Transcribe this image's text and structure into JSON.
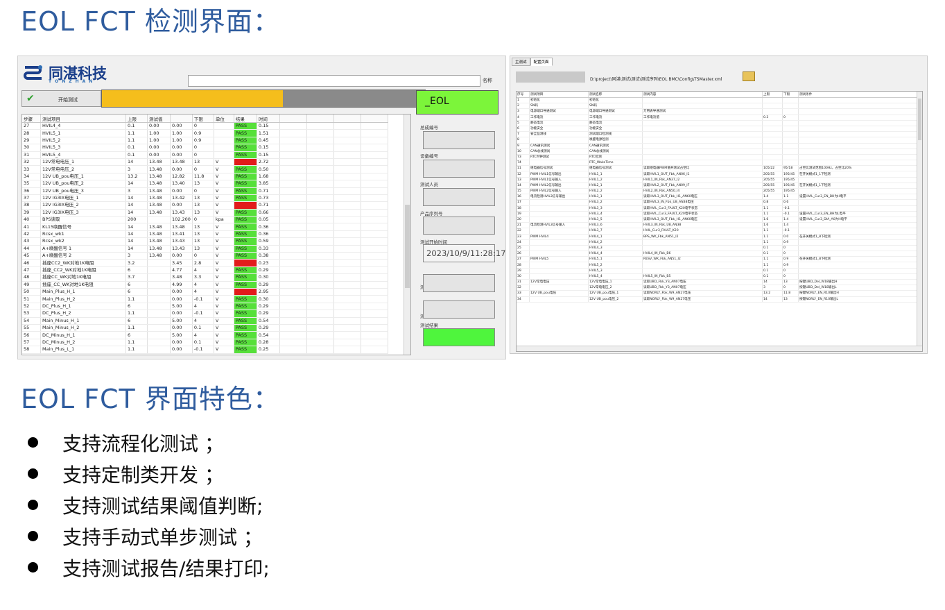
{
  "heading_top": "EOL FCT 检测界面：",
  "heading_bottom": "EOL FCT 界面特色：",
  "left_app": {
    "logo_text": "同湛科技",
    "logo_subtext": "TONZHAN",
    "top_input_label": "名称",
    "start_button": "开始测试",
    "progress": 0.56,
    "status_box": "_EOL",
    "columns": [
      "步骤",
      "测试项目",
      "上限",
      "测试值",
      "下限",
      "单位",
      "结果",
      "时间"
    ],
    "rows": [
      [
        "27",
        "HVIL4_4",
        "0.1",
        "0.00",
        "0.00",
        "0",
        "",
        "PASS",
        "0.15"
      ],
      [
        "28",
        "HVIL5_1",
        "1.1",
        "1.00",
        "1.00",
        "0.9",
        "",
        "PASS",
        "1.51"
      ],
      [
        "29",
        "HVIL5_2",
        "1.1",
        "1.00",
        "1.00",
        "0.9",
        "",
        "PASS",
        "0.45"
      ],
      [
        "30",
        "HVIL5_3",
        "0.1",
        "0.00",
        "0.00",
        "0",
        "",
        "PASS",
        "0.15"
      ],
      [
        "31",
        "HVIL5_4",
        "0.1",
        "0.00",
        "0.00",
        "0",
        "",
        "PASS",
        "0.15"
      ],
      [
        "32",
        "12V常电电压_1",
        "14",
        "13.48",
        "13.48",
        "13",
        "V",
        "FAIL",
        "2.72"
      ],
      [
        "33",
        "12V常电电压_2",
        "3",
        "13.48",
        "0.00",
        "0",
        "V",
        "PASS",
        "0.50"
      ],
      [
        "34",
        "12V UB_pou电压_1",
        "13.2",
        "13.48",
        "12.82",
        "11.8",
        "V",
        "PASS",
        "1.68"
      ],
      [
        "35",
        "12V UB_pou电压_2",
        "14",
        "13.48",
        "13.40",
        "13",
        "V",
        "PASS",
        "3.85"
      ],
      [
        "36",
        "12V UB_pou电压_3",
        "3",
        "13.48",
        "0.00",
        "0",
        "V",
        "PASS",
        "0.71"
      ],
      [
        "37",
        "12V IG3IX电压_1",
        "14",
        "13.48",
        "13.42",
        "13",
        "V",
        "PASS",
        "0.73"
      ],
      [
        "38",
        "12V IG3IX电压_2",
        "14",
        "13.48",
        "0.00",
        "13",
        "V",
        "FAIL",
        "0.71"
      ],
      [
        "39",
        "12V IG3IX电压_3",
        "14",
        "13.48",
        "13.43",
        "13",
        "V",
        "PASS",
        "0.66"
      ],
      [
        "40",
        "BPS读取",
        "200",
        "",
        "102.200",
        "0",
        "kpa",
        "PASS",
        "0.05"
      ],
      [
        "41",
        "KL15唤醒信号",
        "14",
        "13.48",
        "13.48",
        "13",
        "V",
        "PASS",
        "0.36"
      ],
      [
        "42",
        "Rcsx_wk1",
        "14",
        "13.48",
        "13.41",
        "13",
        "V",
        "PASS",
        "0.36"
      ],
      [
        "43",
        "Rcsx_wk2",
        "14",
        "13.48",
        "13.43",
        "13",
        "V",
        "PASS",
        "0.59"
      ],
      [
        "44",
        "A+唤醒信号 1",
        "14",
        "13.48",
        "13.43",
        "13",
        "V",
        "PASS",
        "0.33"
      ],
      [
        "45",
        "A+唤醒信号 2",
        "3",
        "13.48",
        "0.00",
        "0",
        "V",
        "PASS",
        "0.38"
      ],
      [
        "46",
        "插座CC2_WK对地1K电阻",
        "3.2",
        "",
        "3.45",
        "2.8",
        "V",
        "FAIL",
        "0.23"
      ],
      [
        "47",
        "插座_CC2_WK对地1K电阻",
        "6",
        "",
        "4.77",
        "4",
        "V",
        "PASS",
        "0.29"
      ],
      [
        "48",
        "插座CC_WK对地1K电阻",
        "3.7",
        "",
        "3.48",
        "3.3",
        "V",
        "PASS",
        "0.30"
      ],
      [
        "49",
        "插座_CC_WK对地1K电阻",
        "6",
        "",
        "4.99",
        "4",
        "V",
        "PASS",
        "0.29"
      ],
      [
        "50",
        "Main_Plus_H_1",
        "6",
        "",
        "0.00",
        "4",
        "V",
        "FAIL",
        "2.95"
      ],
      [
        "51",
        "Main_Plus_H_2",
        "1.1",
        "",
        "0.00",
        "-0.1",
        "V",
        "PASS",
        "0.30"
      ],
      [
        "52",
        "DC_Plus_H_1",
        "6",
        "",
        "5.00",
        "4",
        "V",
        "PASS",
        "0.29"
      ],
      [
        "53",
        "DC_Plus_H_2",
        "1.1",
        "",
        "0.00",
        "-0.1",
        "V",
        "PASS",
        "0.29"
      ],
      [
        "54",
        "Main_Minus_H_1",
        "6",
        "",
        "5.00",
        "4",
        "V",
        "PASS",
        "0.54"
      ],
      [
        "55",
        "Main_Minus_H_2",
        "1.1",
        "",
        "0.00",
        "0.1",
        "V",
        "PASS",
        "0.29"
      ],
      [
        "56",
        "DC_Minus_H_1",
        "6",
        "",
        "5.00",
        "4",
        "V",
        "PASS",
        "0.54"
      ],
      [
        "57",
        "DC_Minus_H_2",
        "1.1",
        "",
        "0.00",
        "0.1",
        "V",
        "PASS",
        "0.28"
      ],
      [
        "58",
        "Main_Plus_L_1",
        "1.1",
        "",
        "0.00",
        "-0.1",
        "V",
        "PASS",
        "0.25"
      ]
    ],
    "side_labels": [
      "总成编号",
      "设备编号",
      "测试人员",
      "产品序列号",
      "测试开始时间",
      "测试结束时间",
      "测试总用时",
      "测试结果"
    ],
    "start_time": "2023/10/9/11:28:17"
  },
  "right_app": {
    "tabs": [
      "主测试",
      "配置页面"
    ],
    "path": "D:\\project\\同湛\\测试\\测试\\测试序列\\EOL BMC\\Config\\TSMaster.xml",
    "columns": [
      "序号",
      "测试项目",
      "测试名称",
      "测试内容",
      "上限",
      "下限",
      "测试条件"
    ],
    "rows": [
      [
        "1",
        "初始化",
        "初始化",
        "",
        "",
        "",
        ""
      ],
      [
        "2",
        "SN码",
        "SN码",
        "",
        "",
        "",
        ""
      ],
      [
        "3",
        "电源端口导通测试",
        "电源端口导通测试",
        "万用表导通测试",
        "",
        "",
        ""
      ],
      [
        "4",
        "工作电流",
        "工作电流",
        "工作电流值",
        "0.3",
        "0",
        ""
      ],
      [
        "5",
        "静态电流",
        "静态电流",
        "",
        "",
        "",
        ""
      ],
      [
        "6",
        "功能安全",
        "功能安全",
        "",
        "",
        "",
        ""
      ],
      [
        "7",
        "安全监测线",
        "测试端口检测线",
        "",
        "",
        "",
        ""
      ],
      [
        "8",
        "",
        "唤醒电源检测",
        "",
        "",
        "",
        ""
      ],
      [
        "9",
        "CAN通讯测试",
        "CAN通讯测试",
        "",
        "",
        "",
        ""
      ],
      [
        "10",
        "CAN总线测试",
        "CAN总线测试",
        "",
        "",
        "",
        ""
      ],
      [
        "73",
        "RTC时钟测试",
        "RTC检测",
        "",
        "",
        "",
        ""
      ],
      [
        "74",
        "",
        "RTC_WakeTime",
        "",
        "",
        "",
        ""
      ],
      [
        "11",
        "继电器信号测试",
        "继电器信号测试",
        "读取继电器PWM值并测试占空比",
        "105/22",
        "95/18",
        "占空比测试范围100Hz，占空比20%"
      ],
      [
        "12",
        "PWM HVIL1信号输出",
        "HVIL1_1",
        "读取HVIL1_OUT_Fbk_AN06_I1",
        "205/55",
        "195/45",
        "在开关模式1_1下检测"
      ],
      [
        "13",
        "PWM HVIL1信号输入",
        "HVIL1_2",
        "HVIL1_IN_Fbk_AN37_I2",
        "205/55",
        "195/45",
        ""
      ],
      [
        "14",
        "PWM HVIL2信号输出",
        "HVIL2_1",
        "读取HVIL2_OUT_Fbk_AN09_I7",
        "205/55",
        "195/45",
        "在开关模式1_1下检测"
      ],
      [
        "15",
        "PWM HVIL2信号输入",
        "HVIL2_2",
        "HVIL2_IN_Fbk_AN50_I4",
        "205/55",
        "195/45",
        ""
      ],
      [
        "16",
        "电流检测HVIL3信号输出",
        "HVIL3_1",
        "读取HVIL3_OUT_Fbk_H1_AN60电压",
        "1.4",
        "1.1",
        "设置HVIL_Cur3_EN_BH为H电平"
      ],
      [
        "17",
        "",
        "HVIL3_2",
        "读取HVIL3_IN_Fbk_U8_AN38电压",
        "0.8",
        "0.6",
        ""
      ],
      [
        "18",
        "",
        "HVIL3_3",
        "读取HVIL_Cur3_FAULT_K20电平状态",
        "1.1",
        "-0.1",
        ""
      ],
      [
        "19",
        "",
        "HVIL3_4",
        "读取HVIL_Cur3_FAULT_K20电平状态",
        "1.1",
        "-0.1",
        "设置HVIL_Cur3_EN_BH为L电平"
      ],
      [
        "20",
        "",
        "HVIL3_5",
        "读取HVIL3_OUT_Fbk_H1_AN60电压",
        "1.6",
        "1.4",
        "设置HVIL_Cur3_DIA_A0为H电平"
      ],
      [
        "21",
        "电流检测HVIL3信号输入",
        "HVIL3_6",
        "HVIL3_IN_Fbk_U8_AN38",
        "1.6",
        "1.4",
        ""
      ],
      [
        "22",
        "",
        "HVIL3_7",
        "HVIL_Cur3_FAULT_K20",
        "1.1",
        "-0.1",
        ""
      ],
      [
        "23",
        "PWM HVIL4",
        "HVIL4_1",
        "BPS_WK_Fbk_AN51_I2",
        "1.1",
        "0.0",
        "在开关模式1_8下检测"
      ],
      [
        "24",
        "",
        "HVIL4_2",
        "",
        "1.1",
        "0.9",
        ""
      ],
      [
        "25",
        "",
        "HVIL4_3",
        "",
        "0.1",
        "0",
        ""
      ],
      [
        "26",
        "",
        "HVIL4_4",
        "HVIL4_IN_Fbk_B6",
        "0.1",
        "0",
        ""
      ],
      [
        "27",
        "PWM HVIL5",
        "HVIL5_1",
        "RESV_WK_Fbk_AN51_I2",
        "1.1",
        "0.9",
        "在开关模式1_8下检测"
      ],
      [
        "28",
        "",
        "HVIL5_2",
        "",
        "1.1",
        "0.9",
        ""
      ],
      [
        "29",
        "",
        "HVIL5_3",
        "",
        "0.1",
        "0",
        ""
      ],
      [
        "30",
        "",
        "HVIL5_4",
        "HVIL5_IN_Fbk_B5",
        "0.1",
        "0",
        ""
      ],
      [
        "31",
        "12V常电电压",
        "12V常电电压_1",
        "读取UBD_Fbk_Y3_AN07电压",
        "14",
        "13",
        "按键UBD_Del_W18输出H"
      ],
      [
        "32",
        "",
        "12V常电电压_2",
        "读取UBD_Fbk_Y3_AN07电压",
        "3",
        "0",
        "按键UBD_Del_W18输出L"
      ],
      [
        "33",
        "12V UB_pou电压",
        "12V UB_pou电压_1",
        "读取NORLY_Fbk_W9_AN27电压",
        "13.2",
        "11.8",
        "按键NORLY_EN_R10输出H"
      ],
      [
        "34",
        "",
        "12V UB_pou电压_2",
        "读取NORLY_Fbk_W9_AN27电压",
        "14",
        "13",
        "按键NORLY_EN_R10输出L"
      ]
    ]
  },
  "bullets": [
    "支持流程化测试 ；",
    "支持定制类开发 ；",
    "支持测试结果阈值判断;",
    "支持手动式单步测试 ；",
    "支持测试报告/结果打印;"
  ],
  "colors": {
    "heading": "#2f5c9e",
    "pass": "#56e03a",
    "fail": "#e21b1b",
    "progress": "#f5be1c",
    "status": "#7cf53a"
  }
}
